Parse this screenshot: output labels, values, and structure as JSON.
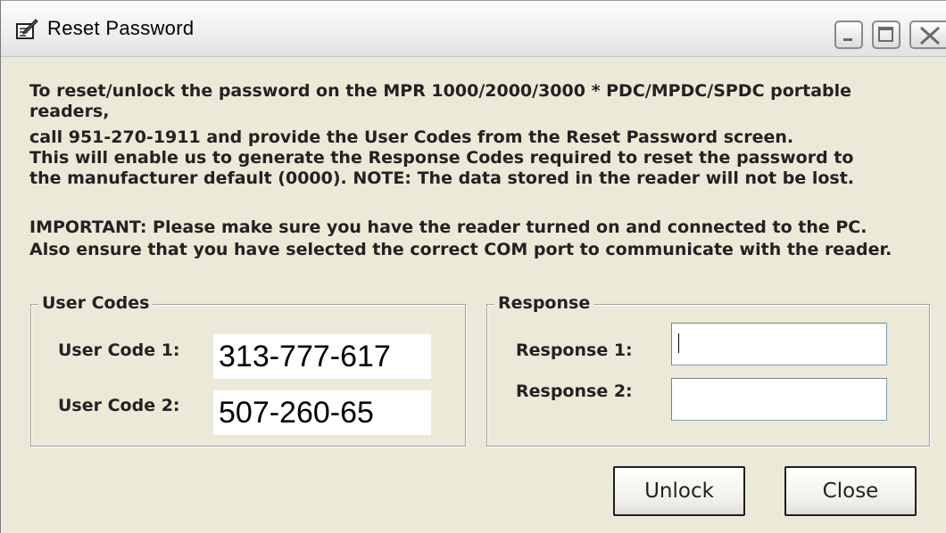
{
  "window": {
    "title": "Reset Password",
    "icon": "pencil-document-icon",
    "controls": {
      "minimize": "minimize-icon",
      "maximize": "maximize-icon",
      "close": "close-icon"
    }
  },
  "instructions": {
    "line1": "To reset/unlock the password on the MPR 1000/2000/3000 * PDC/MPDC/SPDC portable",
    "line2": "readers,",
    "line3": "call 951-270-1911 and provide the User Codes from the Reset Password screen.",
    "line4": "This will enable us to generate the Response Codes required to reset the password to",
    "line5": "the manufacturer default (0000).  NOTE: The data stored in the reader will not be lost.",
    "important1": "IMPORTANT: Please make sure you have the reader turned on and connected to the PC.",
    "important2": "Also ensure that you have selected the correct COM port to communicate with the reader."
  },
  "user_codes": {
    "group_label": "User Codes",
    "code1_label": "User Code 1:",
    "code1_value": "313-777-617",
    "code2_label": "User Code 2:",
    "code2_value": "507-260-65"
  },
  "response": {
    "group_label": "Response",
    "response1_label": "Response 1:",
    "response1_value": "",
    "response2_label": "Response 2:",
    "response2_value": ""
  },
  "buttons": {
    "unlock": "Unlock",
    "close": "Close"
  },
  "colors": {
    "window_bg": "#ece9d8",
    "text": "#222222"
  }
}
